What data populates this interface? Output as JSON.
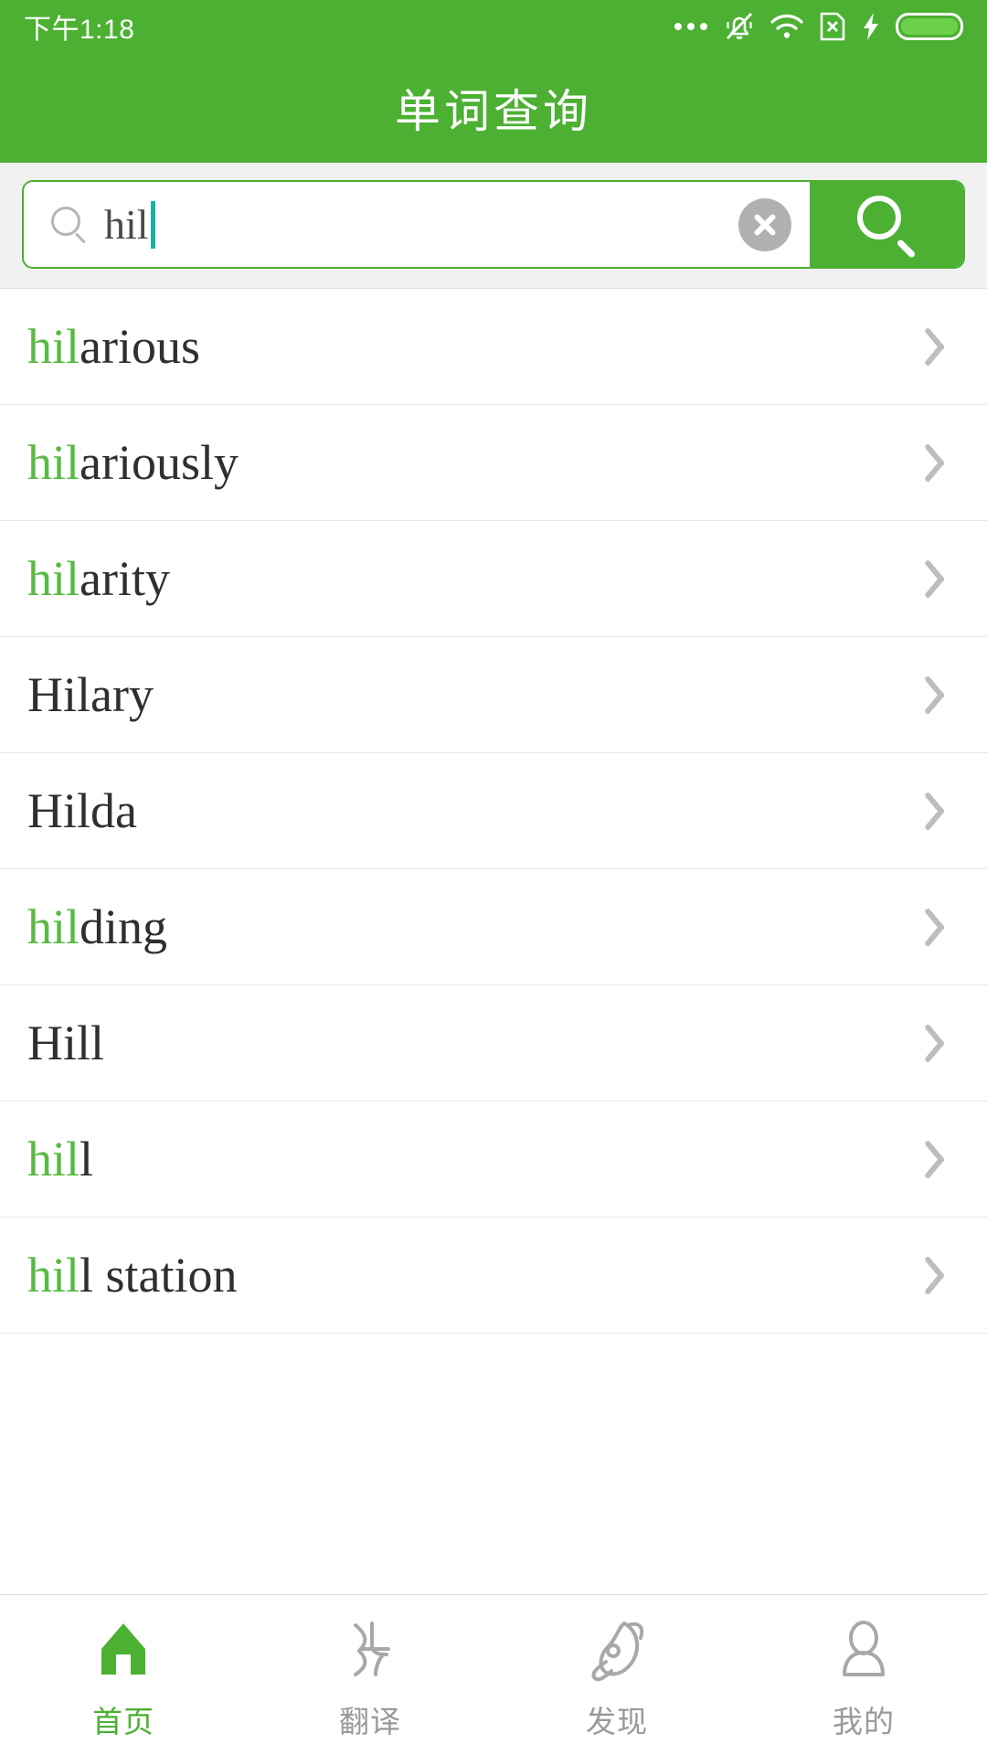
{
  "statusbar": {
    "time": "下午1:18",
    "icons": [
      "more-dots-icon",
      "bell-muted-icon",
      "wifi-icon",
      "sim-card-x-icon",
      "charging-bolt-icon",
      "battery-icon"
    ]
  },
  "header": {
    "title": "单词查询"
  },
  "search": {
    "value": "hil",
    "placeholder": "",
    "clear_label": "",
    "search_button_label": ""
  },
  "results": [
    {
      "prefix": "hil",
      "rest": "arious",
      "full": "hilarious"
    },
    {
      "prefix": "hil",
      "rest": "ariously",
      "full": "hilariously"
    },
    {
      "prefix": "hil",
      "rest": "arity",
      "full": "hilarity"
    },
    {
      "prefix": "",
      "rest": "Hilary",
      "full": "Hilary"
    },
    {
      "prefix": "",
      "rest": "Hilda",
      "full": "Hilda"
    },
    {
      "prefix": "hil",
      "rest": "ding",
      "full": "hilding"
    },
    {
      "prefix": "",
      "rest": "Hill",
      "full": "Hill"
    },
    {
      "prefix": "hil",
      "rest": "l",
      "full": "hill"
    },
    {
      "prefix": "hil",
      "rest": "l station",
      "full": "hill station"
    }
  ],
  "bottomnav": {
    "items": [
      {
        "label": "首页",
        "icon": "home-icon",
        "active": true
      },
      {
        "label": "翻译",
        "icon": "translate-icon",
        "active": false
      },
      {
        "label": "发现",
        "icon": "rocket-icon",
        "active": false
      },
      {
        "label": "我的",
        "icon": "person-icon",
        "active": false
      }
    ]
  },
  "colors": {
    "brand_green": "#4cb033",
    "highlight_green": "#5aba44",
    "caret_teal": "#17b2a5",
    "text_dark": "#2f2f2f",
    "muted_gray": "#9a9a9a"
  }
}
